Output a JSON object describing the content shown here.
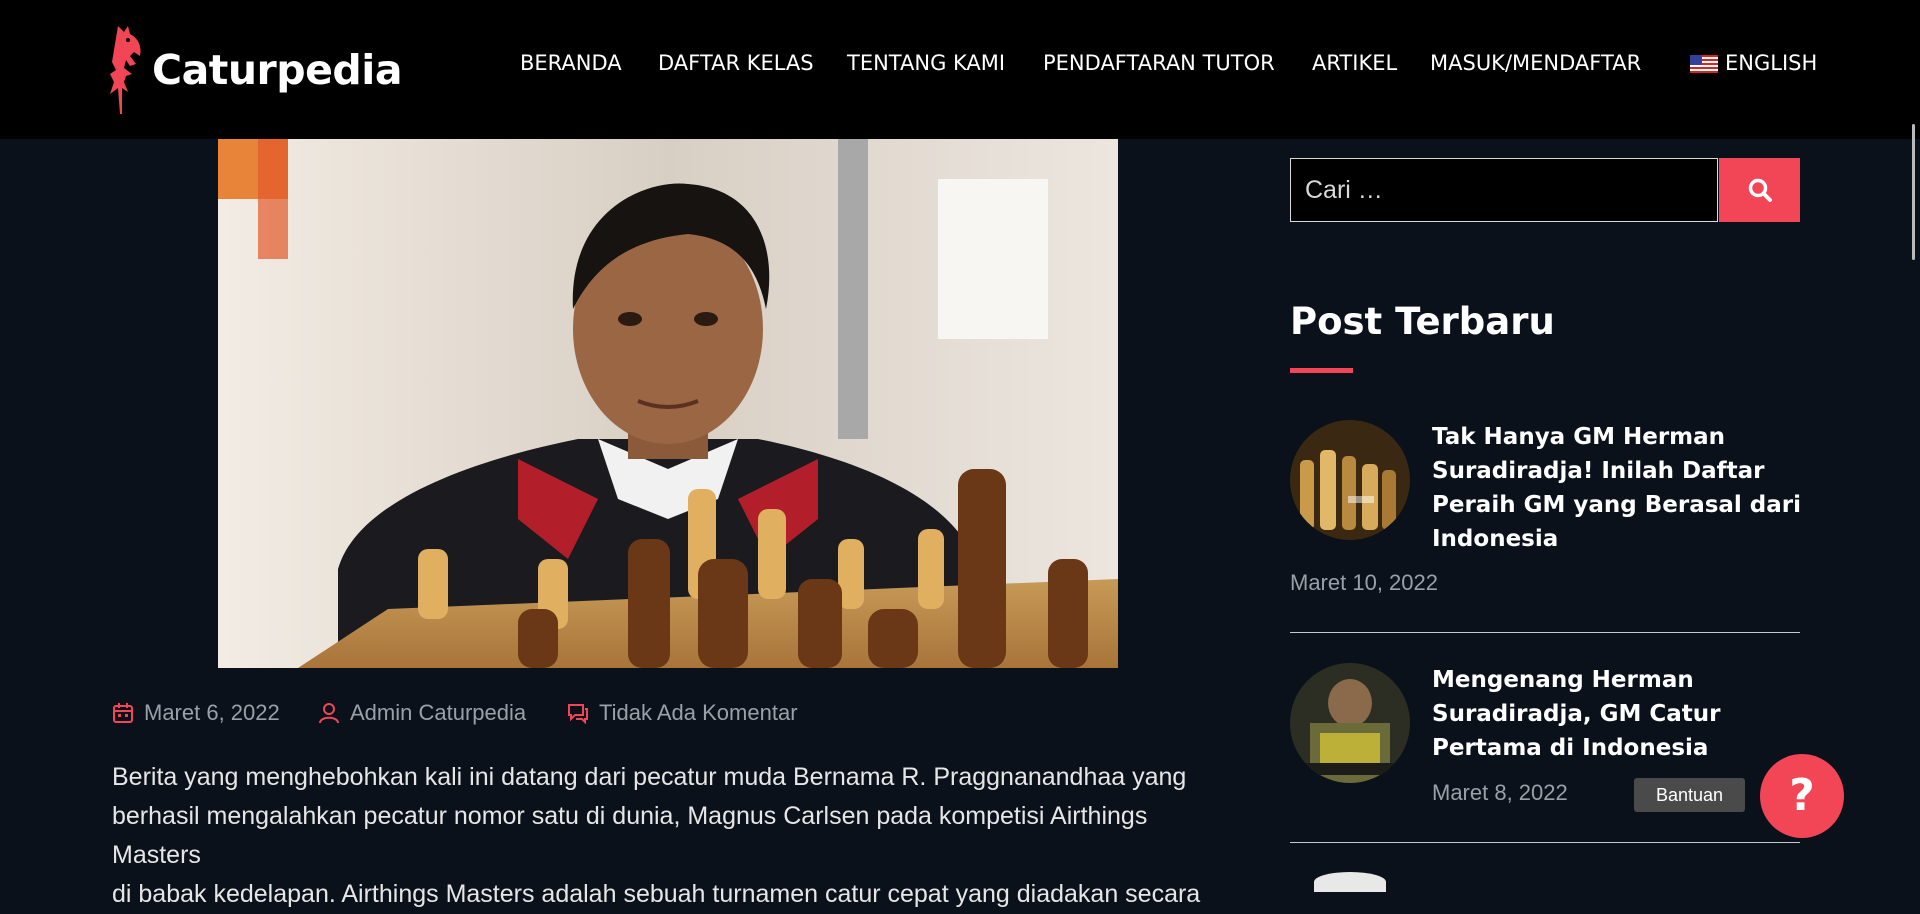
{
  "header": {
    "brand": "Caturpedia",
    "nav": [
      {
        "label": "BERANDA"
      },
      {
        "label": "DAFTAR KELAS"
      },
      {
        "label": "TENTANG KAMI"
      },
      {
        "label": "PENDAFTARAN TUTOR"
      },
      {
        "label": "ARTIKEL"
      },
      {
        "label": "MASUK/MENDAFTAR"
      },
      {
        "label": "ENGLISH",
        "icon": "us-flag-icon"
      }
    ]
  },
  "article": {
    "meta": {
      "date": "Maret 6, 2022",
      "author": "Admin Caturpedia",
      "comments": "Tidak Ada Komentar"
    },
    "body_lines": [
      "Berita yang menghebohkan kali ini datang dari pecatur muda Bernama R. Praggnanandhaa yang",
      "berhasil mengalahkan pecatur nomor satu di dunia, Magnus Carlsen pada kompetisi Airthings Masters",
      "di babak kedelapan. Airthings Masters adalah sebuah turnamen catur cepat yang diadakan secara"
    ]
  },
  "sidebar": {
    "search": {
      "placeholder": "Cari …"
    },
    "recent_title": "Post Terbaru",
    "posts": [
      {
        "title_lines": [
          "Tak Hanya GM Herman",
          "Suradiradja! Inilah Daftar",
          "Peraih GM yang Berasal dari",
          "Indonesia"
        ],
        "date": "Maret 10, 2022"
      },
      {
        "title_lines": [
          "Mengenang Herman",
          "Suradiradja, GM Catur",
          "Pertama di Indonesia"
        ],
        "date": "Maret 8, 2022"
      }
    ]
  },
  "help": {
    "tooltip": "Bantuan",
    "button": "?"
  },
  "colors": {
    "accent": "#f24656",
    "background": "#0b111a",
    "header": "#000000"
  }
}
